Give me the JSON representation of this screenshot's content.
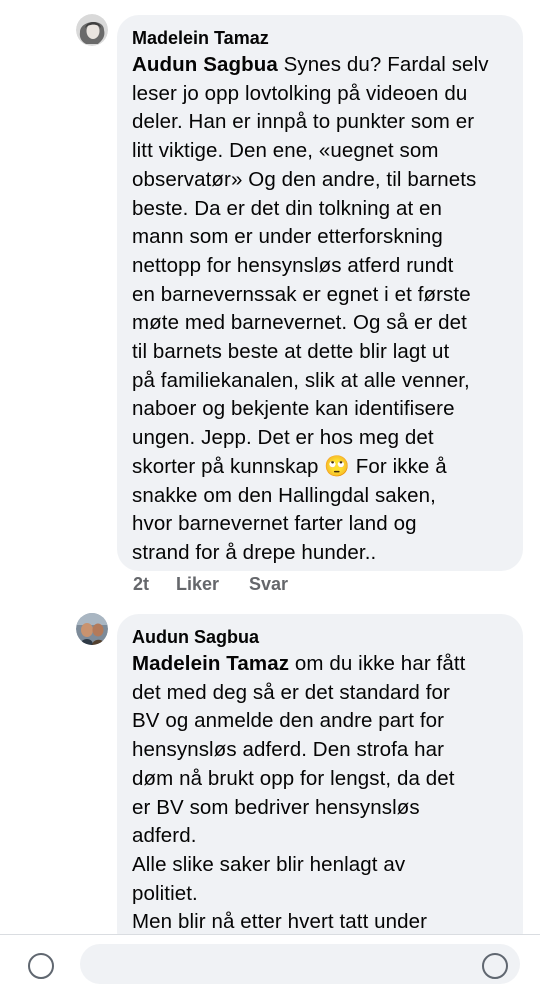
{
  "comments": [
    {
      "author": "Madelein Tamaz",
      "mention": "Audun Sagbua",
      "text": " Synes du? Fardal selv\nleser jo opp lovtolking på videoen du\ndeler. Han er innpå to punkter som er\nlitt viktige. Den ene, «uegnet som\nobservatør» Og den andre, til barnets\nbeste. Da er det din tolkning at en\nmann som er under etterforskning\nnettopp for hensynsløs atferd rundt\nen barnevernssak er egnet i et første\nmøte med barnevernet. Og så er det\ntil barnets beste at dette blir lagt ut\npå familiekanalen, slik at alle venner,\nnaboer og bekjente kan identifisere\nungen. Jepp. Det er hos meg det\nskorter på kunnskap ",
      "emoji": "🙄",
      "text_after": " For ikke å\nsnakke om den Hallingdal saken,\nhvor barnevernet farter land og\nstrand for å drepe hunder..",
      "time": "2t",
      "like_label": "Liker",
      "reply_label": "Svar"
    },
    {
      "author": "Audun Sagbua",
      "mention": "Madelein Tamaz",
      "text": " om du ikke har fått\ndet med deg så er det standard for\nBV og anmelde den andre part for\nhensynsløs adferd. Den strofa har\ndøm nå brukt opp for lengst, da det\ner BV som bedriver hensynsløs\nadferd.\nAlle slike saker blir henlagt av\npolitiet.\nMen blir nå etter hvert tatt under"
    }
  ],
  "colors": {
    "bubble": "#f0f2f5",
    "meta": "#65676b",
    "text": "#050505"
  },
  "icons": [
    "avatar-madelein",
    "avatar-audun",
    "emoji-rolling-eyes",
    "camera-icon",
    "gif-icon"
  ]
}
